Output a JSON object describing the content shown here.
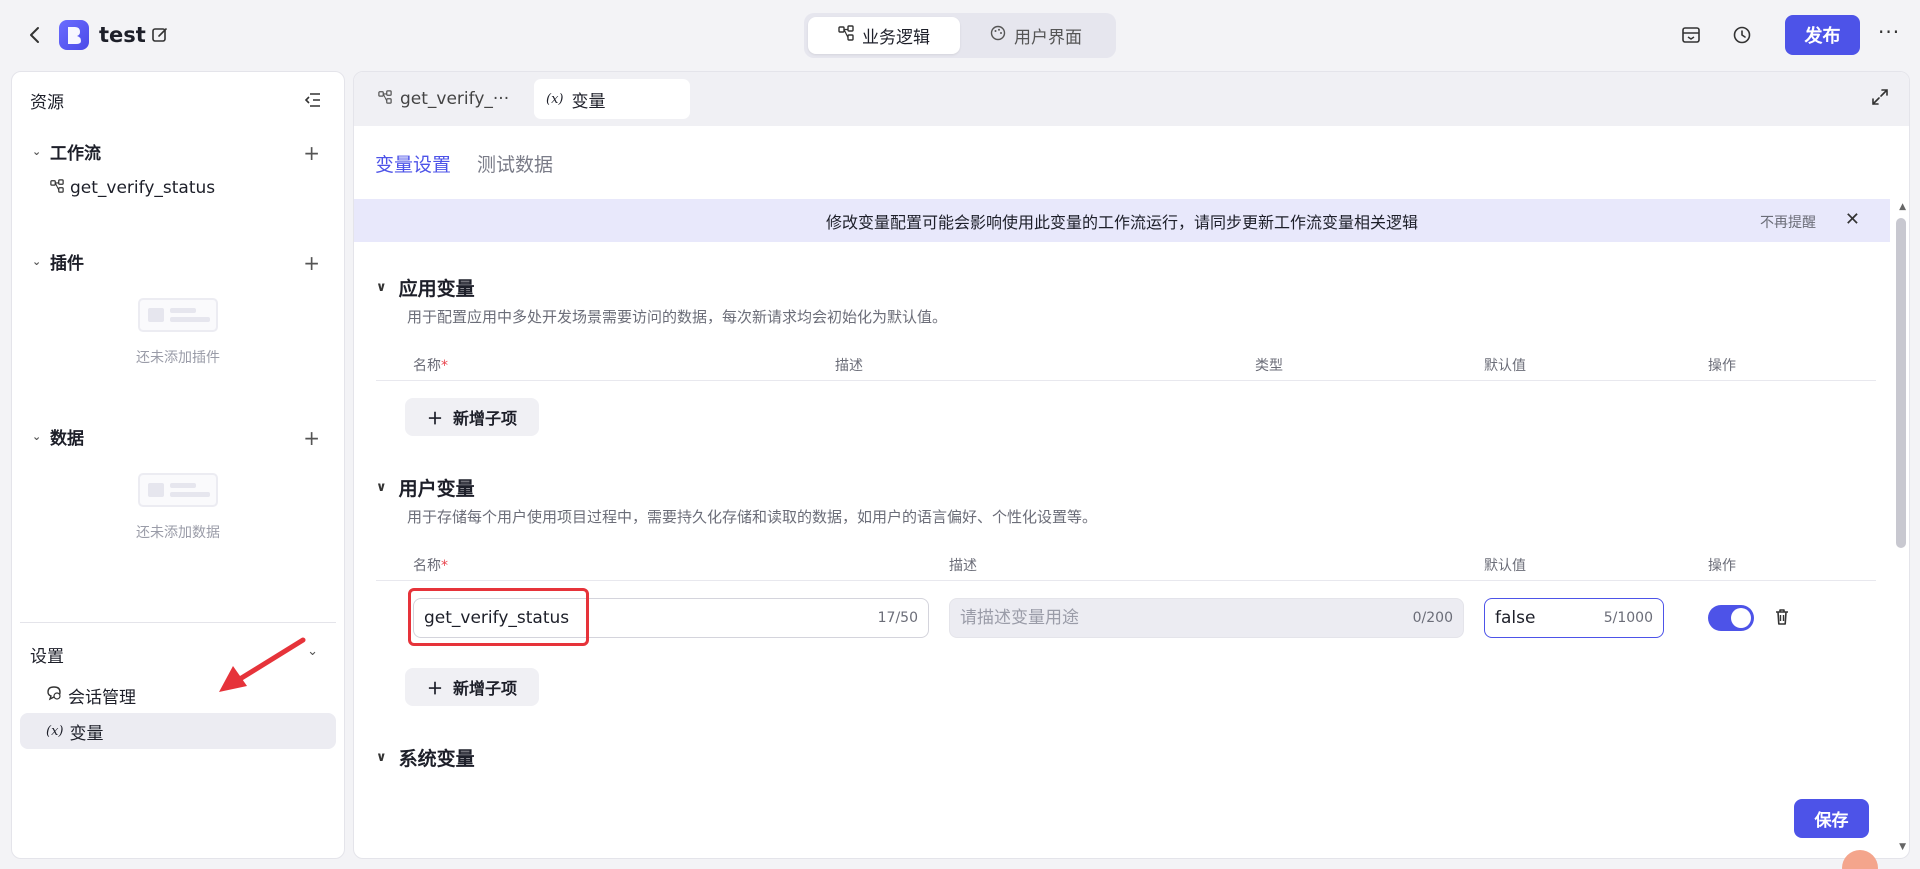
{
  "app": {
    "title": "test",
    "logo_color": "#5b5cf0"
  },
  "header": {
    "modes": [
      {
        "label": "业务逻辑",
        "active": true
      },
      {
        "label": "用户界面",
        "active": false
      }
    ],
    "publish_label": "发布",
    "more_label": "···"
  },
  "sidebar": {
    "title": "资源",
    "sections": {
      "workflow": {
        "title": "工作流",
        "add": "+",
        "items": [
          "get_verify_status"
        ]
      },
      "plugin": {
        "title": "插件",
        "add": "+",
        "empty": "还未添加插件"
      },
      "data": {
        "title": "数据",
        "add": "+",
        "empty": "还未添加数据"
      }
    },
    "settings": {
      "title": "设置",
      "items": [
        {
          "label": "会话管理",
          "active": false
        },
        {
          "label": "变量",
          "active": true
        }
      ]
    }
  },
  "main": {
    "file_tabs": [
      {
        "label": "get_verify_···",
        "active": false
      },
      {
        "label": "变量",
        "active": true
      }
    ],
    "sub_tabs": [
      {
        "label": "变量设置",
        "active": true
      },
      {
        "label": "测试数据",
        "active": false
      }
    ],
    "notice": {
      "text": "修改变量配置可能会影响使用此变量的工作流运行，请同步更新工作流变量相关逻辑",
      "dismiss": "不再提醒",
      "close": "✕"
    },
    "app_vars": {
      "title": "应用变量",
      "desc": "用于配置应用中多处开发场景需要访问的数据，每次新请求均会初始化为默认值。",
      "columns": {
        "name": "名称",
        "desc": "描述",
        "type": "类型",
        "default": "默认值",
        "action": "操作"
      },
      "add_label": "新增子项"
    },
    "user_vars": {
      "title": "用户变量",
      "desc": "用于存储每个用户使用项目过程中，需要持久化存储和读取的数据，如用户的语言偏好、个性化设置等。",
      "columns": {
        "name": "名称",
        "desc": "描述",
        "default": "默认值",
        "action": "操作"
      },
      "row": {
        "name_value": "get_verify_status",
        "name_count": "17/50",
        "desc_placeholder": "请描述变量用途",
        "desc_count": "0/200",
        "default_value": "false",
        "default_count": "5/1000",
        "enabled": true
      },
      "add_label": "新增子项"
    },
    "sys_vars": {
      "title": "系统变量"
    },
    "save_label": "保存"
  },
  "colors": {
    "accent": "#4d53e8",
    "highlight": "#e6333a",
    "notice_bg": "#e8e8fb"
  }
}
